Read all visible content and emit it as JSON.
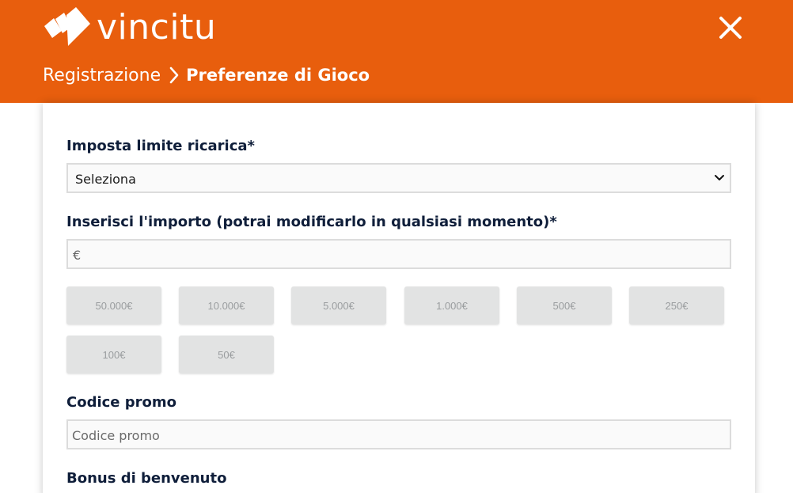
{
  "brand": {
    "name": "vincitu",
    "color": "#e85e0d"
  },
  "header": {
    "breadcrumb": [
      "Registrazione",
      "Preferenze di Gioco"
    ],
    "close_icon": "close-icon"
  },
  "form": {
    "deposit_limit": {
      "label": "Imposta limite ricarica*",
      "selected": "Seleziona"
    },
    "amount": {
      "label": "Inserisci l'importo (potrai modificarlo in qualsiasi momento)*",
      "currency_symbol": "€",
      "presets": [
        "50.000€",
        "10.000€",
        "5.000€",
        "1.000€",
        "500€",
        "250€",
        "100€",
        "50€"
      ]
    },
    "promo": {
      "label": "Codice promo",
      "placeholder": "Codice promo"
    },
    "bonus": {
      "label": "Bonus di benvenuto"
    }
  }
}
